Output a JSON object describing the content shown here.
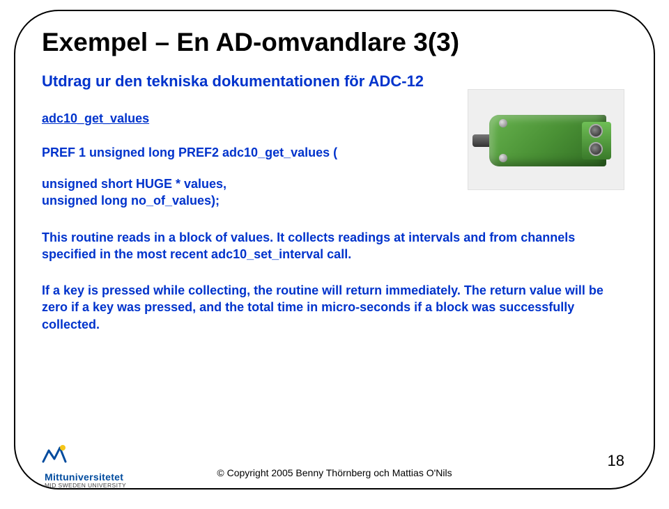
{
  "title": "Exempel – En AD-omvandlare 3(3)",
  "subtitle": "Utdrag ur den tekniska dokumentationen för ADC-12",
  "func_name": "adc10_get_values",
  "signature_line": "PREF 1 unsigned long PREF2 adc10_get_values (",
  "signature_block_1": "unsigned short HUGE * values,",
  "signature_block_2": "unsigned long no_of_values);",
  "para1": "This routine reads in a block of values. It collects readings at intervals and from channels specified in the most recent adc10_set_interval call.",
  "para2": "If a key is pressed while collecting, the routine will return immediately. The return value will be zero if a key was pressed, and the total time in micro-seconds if a block was successfully collected.",
  "footer": {
    "logo_line1": "Mittuniversitetet",
    "logo_line2": "MID SWEDEN UNIVERSITY",
    "copyright": "© Copyright 2005 Benny Thörnberg och Mattias O'Nils",
    "page_number": "18"
  },
  "image": {
    "name": "connector-photo",
    "alt": "Green D-sub style AD converter connector"
  }
}
